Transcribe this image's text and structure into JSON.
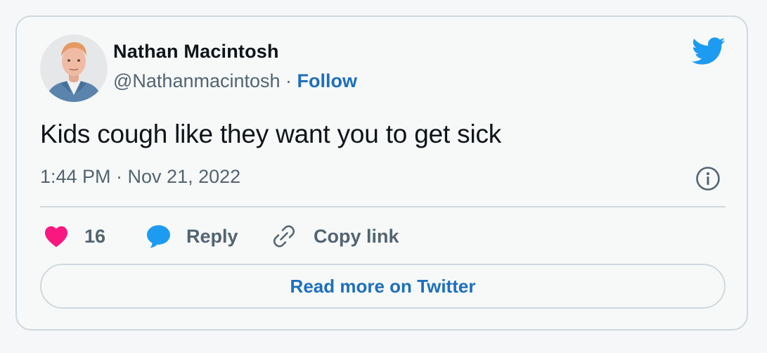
{
  "author": {
    "name": "Nathan Macintosh",
    "handle": "@Nathanmacintosh",
    "separator": " · ",
    "follow_label": "Follow"
  },
  "tweet": {
    "text": "Kids cough like they want you to get sick",
    "timestamp": "1:44 PM · Nov 21, 2022"
  },
  "actions": {
    "like_count": "16",
    "reply_label": "Reply",
    "copy_link_label": "Copy link"
  },
  "read_more_label": "Read more on Twitter",
  "icons": {
    "brand": "twitter-bird-icon",
    "info": "info-icon",
    "like": "heart-icon",
    "reply": "speech-bubble-icon",
    "copy": "link-icon"
  },
  "colors": {
    "accent": "#1d6fbd",
    "twitter_blue": "#1d9bf0",
    "heart": "#f91880",
    "muted_text": "#536471",
    "border": "#cfd9de"
  }
}
